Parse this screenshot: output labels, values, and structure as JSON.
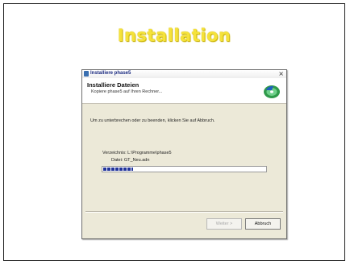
{
  "slide": {
    "title": "Installation"
  },
  "dialog": {
    "window_title": "Installiere phase5",
    "close_glyph": "×",
    "header": {
      "title": "Installiere Dateien",
      "subtitle": "Kopiere phase5 auf Ihren Rechner...",
      "icon": "installer-disc-icon"
    },
    "info_text": "Um zu unterbrechen oder zu beenden, klicken Sie auf Abbruch.",
    "directory_line": "Verzeichnis: L:\\Programme\\phase5",
    "file_line": "Datei: GT_Neu.adn",
    "progress": {
      "fraction": 0.18
    },
    "buttons": {
      "next_label": "Weiter >",
      "cancel_label": "Abbruch"
    }
  }
}
